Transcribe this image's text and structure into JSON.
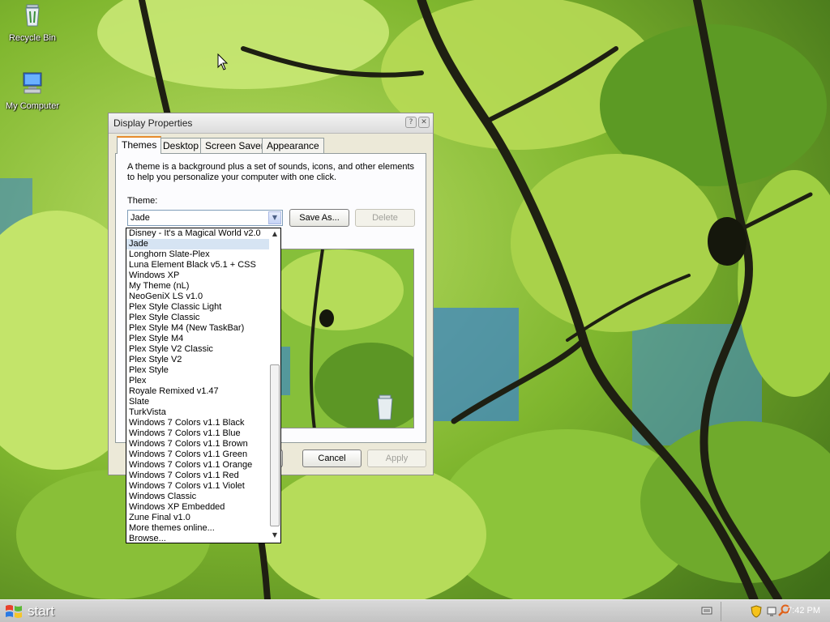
{
  "desktop": {
    "icons": [
      {
        "label": "Recycle Bin",
        "icon": "recycle-bin-icon"
      },
      {
        "label": "My Computer",
        "icon": "my-computer-icon"
      }
    ]
  },
  "window": {
    "title": "Display Properties",
    "tabs": [
      {
        "label": "Themes",
        "active": true
      },
      {
        "label": "Desktop",
        "active": false
      },
      {
        "label": "Screen Saver",
        "active": false
      },
      {
        "label": "Appearance",
        "active": false
      }
    ],
    "description": "A theme is a background plus a set of sounds, icons, and other elements to help you personalize your computer with one click.",
    "theme_label": "Theme:",
    "theme_value": "Jade",
    "buttons": {
      "save_as": "Save As...",
      "delete": "Delete",
      "cancel": "Cancel",
      "apply": "Apply"
    }
  },
  "dropdown": {
    "selected": "Jade",
    "items": [
      "Disney - It's a Magical World v2.0",
      "Jade",
      "Longhorn Slate-Plex",
      "Luna Element Black v5.1 + CSS",
      "Windows XP",
      "My Theme (nL)",
      "NeoGeniX LS v1.0",
      "Plex Style Classic Light",
      "Plex Style Classic",
      "Plex Style M4 (New TaskBar)",
      "Plex Style M4",
      "Plex Style V2 Classic",
      "Plex Style V2",
      "Plex Style",
      "Plex",
      "Royale Remixed v1.47",
      "Slate",
      "TurkVista",
      "Windows 7 Colors v1.1 Black",
      "Windows 7 Colors v1.1 Blue",
      "Windows 7 Colors v1.1 Brown",
      "Windows 7 Colors v1.1 Green",
      "Windows 7 Colors v1.1 Orange",
      "Windows 7 Colors v1.1 Red",
      "Windows 7 Colors v1.1 Violet",
      "Windows Classic",
      "Windows XP Embedded",
      "Zune Final v1.0",
      "More themes online...",
      "Browse..."
    ]
  },
  "taskbar": {
    "start_label": "start",
    "clock": "7:42 PM",
    "tray_icons": [
      "security-shield-icon",
      "network-icon",
      "search-icon"
    ]
  },
  "colors": {
    "selection": "#d6e4f3",
    "window_bg": "#ece9d8",
    "active_tab_accent": "#e68b2c"
  }
}
